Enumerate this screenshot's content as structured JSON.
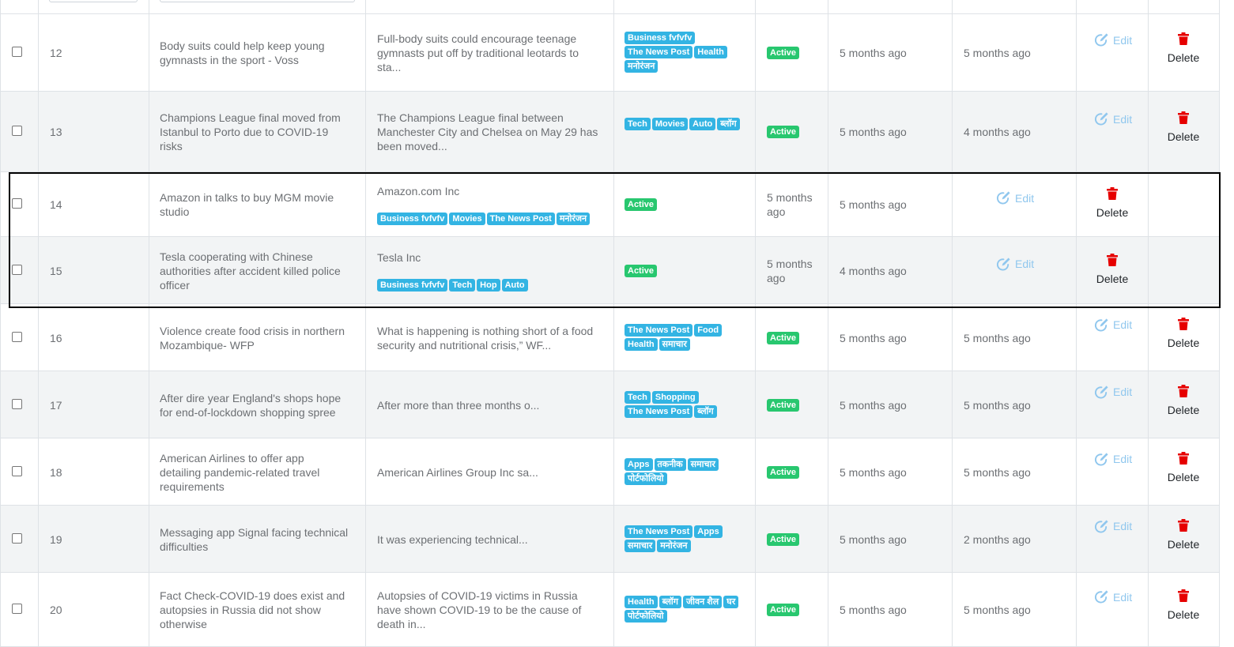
{
  "labels": {
    "edit": "Edit",
    "delete": "Delete",
    "status_active": "Active"
  },
  "colors": {
    "tag_bg": "#33b4e3",
    "active_badge": "#28c76f",
    "edit_link": "#90c7ee",
    "delete_icon": "#e60000",
    "highlight_border": "#000000"
  },
  "rows": [
    {
      "id": "12",
      "title_lines": [
        "Body suits could help keep young",
        "gymnasts in the sport - Voss"
      ],
      "summary_lines": [
        "Full-body suits could encourage teenage",
        "gymnasts put off by traditional leotards to",
        "sta..."
      ],
      "tags": [
        "Business fvfvfv",
        "The News Post",
        "Health",
        "मनोरंजन"
      ],
      "status": "Active",
      "created": "5 months ago",
      "updated": "5 months ago"
    },
    {
      "id": "13",
      "title_lines": [
        "Champions League final moved from",
        "Istanbul to Porto due to COVID-19",
        "risks"
      ],
      "summary_lines": [
        "The Champions League final between",
        "Manchester City and Chelsea on May 29 has",
        "been moved..."
      ],
      "tags": [
        "Tech",
        "Movies",
        "Auto",
        "ब्लॉग"
      ],
      "status": "Active",
      "created": "5 months ago",
      "updated": "4 months ago"
    },
    {
      "id": "14",
      "title_lines": [
        "Amazon in talks to buy MGM movie",
        "studio"
      ],
      "summary_lines": [
        "Amazon.com Inc"
      ],
      "tags": [
        "Business fvfvfv",
        "Movies",
        "The News Post",
        "मनोरंजन"
      ],
      "status": "Active",
      "created_lines": [
        "5 months",
        "ago"
      ],
      "updated": "5 months ago"
    },
    {
      "id": "15",
      "title_lines": [
        "Tesla cooperating with Chinese",
        "authorities after accident killed police",
        "officer"
      ],
      "summary_lines": [
        "Tesla Inc"
      ],
      "tags": [
        "Business fvfvfv",
        "Tech",
        "Hop",
        "Auto"
      ],
      "status": "Active",
      "created_lines": [
        "5 months",
        "ago"
      ],
      "updated": "4 months ago"
    },
    {
      "id": "16",
      "title_lines": [
        "Violence create food crisis in northern",
        "Mozambique- WFP"
      ],
      "summary_lines": [
        "What is happening is nothing short of a food",
        "security and nutritional crisis,” WF..."
      ],
      "tags": [
        "The News Post",
        "Food",
        "Health",
        "समाचार"
      ],
      "status": "Active",
      "created": "5 months ago",
      "updated": "5 months ago"
    },
    {
      "id": "17",
      "title_lines": [
        "After dire year England's shops hope",
        "for end-of-lockdown shopping spree"
      ],
      "summary_lines": [
        "After more than three months o..."
      ],
      "tags": [
        "Tech",
        "Shopping",
        "The News Post",
        "ब्लॉग"
      ],
      "status": "Active",
      "created": "5 months ago",
      "updated": "5 months ago"
    },
    {
      "id": "18",
      "title_lines": [
        "American Airlines to offer app",
        "detailing pandemic-related travel",
        "requirements"
      ],
      "summary_lines": [
        "American Airlines Group Inc sa..."
      ],
      "tags": [
        "Apps",
        "तकनीक",
        "समाचार",
        "पोर्टफोलियो"
      ],
      "status": "Active",
      "created": "5 months ago",
      "updated": "5 months ago"
    },
    {
      "id": "19",
      "title_lines": [
        "Messaging app Signal facing technical",
        "difficulties"
      ],
      "summary_lines": [
        "It was experiencing technical..."
      ],
      "tags": [
        "The News Post",
        "Apps",
        "समाचार",
        "मनोरंजन"
      ],
      "status": "Active",
      "created": "5 months ago",
      "updated": "2 months ago"
    },
    {
      "id": "20",
      "title_lines": [
        "Fact Check-COVID-19 does exist and",
        "autopsies in Russia did not show",
        "otherwise"
      ],
      "summary_lines": [
        "Autopsies of COVID-19 victims in Russia",
        "have shown COVID-19 to be the cause of",
        "death in..."
      ],
      "tags": [
        "Health",
        "ब्लॉग",
        "जीवन शैल",
        "घर",
        "पोर्टफोलियो"
      ],
      "status": "Active",
      "created": "5 months ago",
      "updated": "5 months ago"
    }
  ]
}
